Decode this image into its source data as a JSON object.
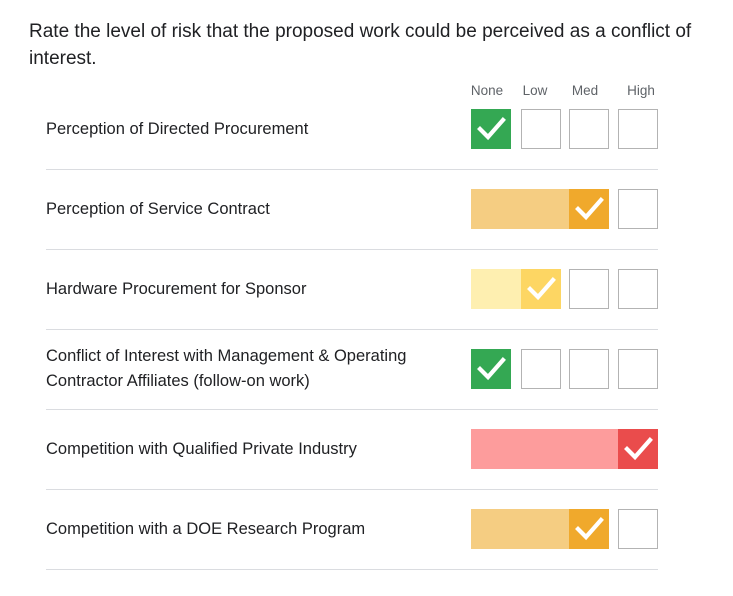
{
  "question": "Rate the level of risk that the proposed work could be perceived as a conflict of interest.",
  "scale_headers": [
    "None",
    "Low",
    "Med",
    "High"
  ],
  "colors": {
    "none": "#34a853",
    "low_dark": "#fdd663",
    "low_light": "#feefb0",
    "med_dark": "#f0a92c",
    "med_light": "#f5cd82",
    "high_dark": "#ea4c4c",
    "high_light": "#fd9c9c"
  },
  "rows": [
    {
      "label": "Perception of Directed Procurement",
      "rating": "None"
    },
    {
      "label": "Perception of Service Contract",
      "rating": "Med"
    },
    {
      "label": "Hardware Procurement for Sponsor",
      "rating": "Low"
    },
    {
      "label": "Conflict of Interest with Management & Operating Contractor Affiliates (follow-on work)",
      "rating": "None"
    },
    {
      "label": "Competition with Qualified Private Industry",
      "rating": "High"
    },
    {
      "label": "Competition with a DOE Research Program",
      "rating": "Med"
    }
  ],
  "check_icon": "check-icon"
}
